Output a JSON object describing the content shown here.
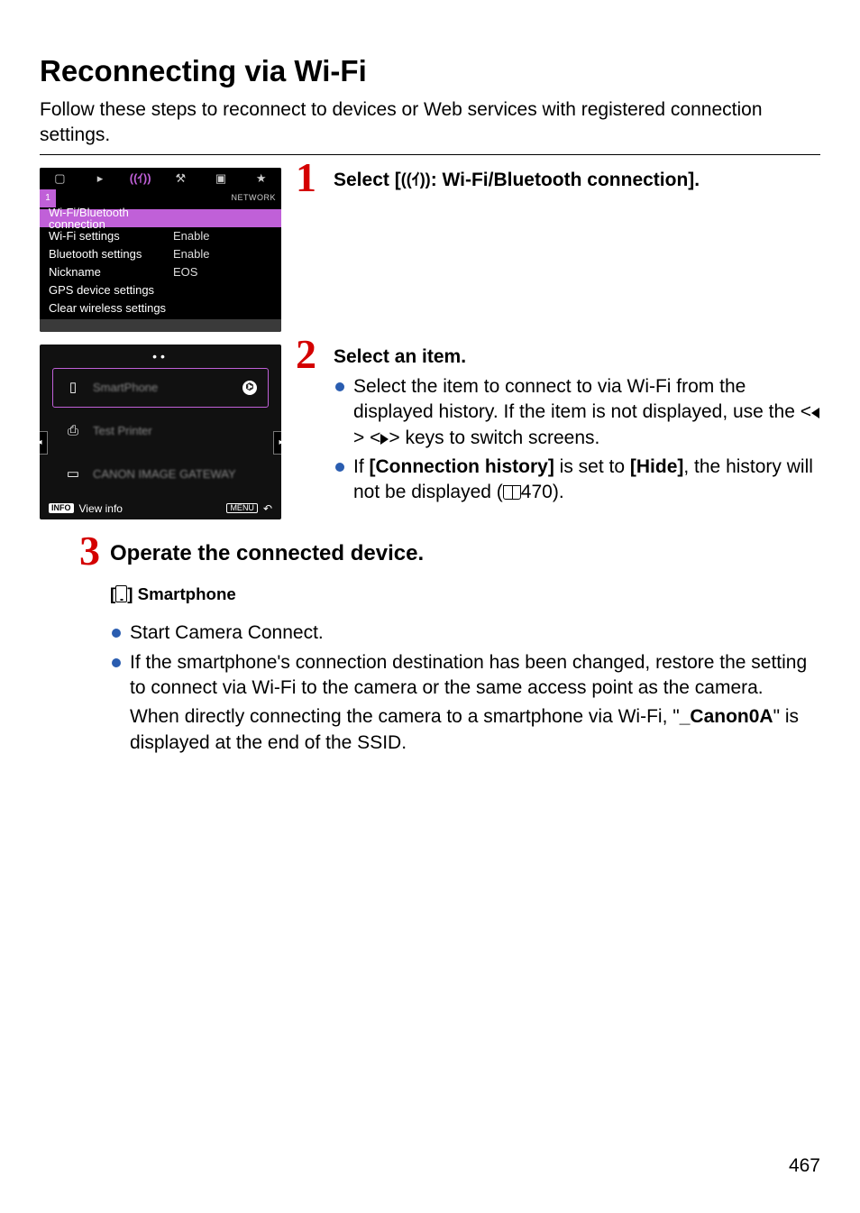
{
  "title": "Reconnecting via Wi-Fi",
  "intro": "Follow these steps to reconnect to devices or Web services with registered connection settings.",
  "screenshot1": {
    "page_indicator": "1",
    "network_label": "NETWORK",
    "items": [
      {
        "k": "Wi-Fi/Bluetooth connection",
        "v": "",
        "sel": true
      },
      {
        "k": "Wi-Fi settings",
        "v": "Enable"
      },
      {
        "k": "Bluetooth settings",
        "v": "Enable"
      },
      {
        "k": "Nickname",
        "v": "EOS"
      },
      {
        "k": "GPS device settings",
        "v": ""
      },
      {
        "k": "Clear wireless settings",
        "v": ""
      }
    ]
  },
  "screenshot2": {
    "history": [
      {
        "icon": "phone",
        "label": "SmartPhone",
        "bt": true,
        "sel": true
      },
      {
        "icon": "printer",
        "label": "Test Printer"
      },
      {
        "icon": "monitor",
        "label": "CANON IMAGE GATEWAY"
      }
    ],
    "info_badge": "INFO",
    "info_text": "View info",
    "menu_badge": "MENU"
  },
  "step1": {
    "num": "1",
    "head_pre": "Select [",
    "head_post": ": Wi-Fi/Bluetooth connection]."
  },
  "step2": {
    "num": "2",
    "head": "Select an item.",
    "b1_a": "Select the item to connect to via Wi-Fi from the displayed history. If the item is not displayed, use the <",
    "b1_b": "> <",
    "b1_c": "> keys to switch screens.",
    "b2_a": "If ",
    "b2_b": "[Connection history]",
    "b2_c": " is set to ",
    "b2_d": "[Hide]",
    "b2_e": ", the history will not be displayed (",
    "b2_ref": "470",
    "b2_f": ")."
  },
  "step3": {
    "num": "3",
    "head": "Operate the connected device.",
    "sub_pre": "[",
    "sub_post": "] Smartphone",
    "b1": "Start Camera Connect.",
    "b2": "If the smartphone's connection destination has been changed, restore the setting to connect via Wi-Fi to the camera or the same access point as the camera.",
    "note_a": "When directly connecting the camera to a smartphone via Wi-Fi, \"",
    "note_b": "_Canon0A",
    "note_c": "\" is displayed at the end of the SSID."
  },
  "page_number": "467"
}
